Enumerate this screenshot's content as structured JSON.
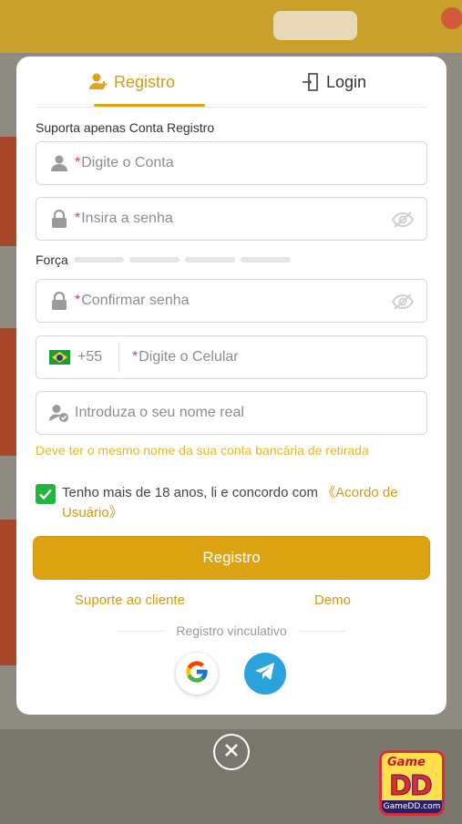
{
  "tabs": {
    "register_label": "Registro",
    "login_label": "Login"
  },
  "note": "Suporta apenas Conta Registro",
  "fields": {
    "account": {
      "required_mark": "*",
      "placeholder": "Digite o Conta"
    },
    "password": {
      "required_mark": "*",
      "placeholder": "Insira a senha"
    },
    "confirm": {
      "required_mark": "*",
      "placeholder": "Confirmar senha"
    },
    "phone": {
      "country_code": "+55",
      "required_mark": "*",
      "placeholder": "Digite o Celular"
    },
    "real_name": {
      "placeholder": "Introduza o seu nome real"
    }
  },
  "strength_label": "Força",
  "real_name_hint": "Deve ter o mesmo nome da sua conta bancária de retirada",
  "agreement": {
    "text": "Tenho mais de 18 anos, li e concordo com ",
    "link": "《Acordo de Usuário》",
    "checked": true
  },
  "submit_label": "Registro",
  "links": {
    "support": "Suporte ao cliente",
    "demo": "Demo"
  },
  "binding_label": "Registro vinculativo",
  "social": [
    "google-icon",
    "telegram-icon"
  ],
  "logo": {
    "top": "Game",
    "main": "DD",
    "domain": "GameDD.com"
  },
  "colors": {
    "accent": "#dea312",
    "link": "#d79a12",
    "hint": "#e7b71f",
    "required": "#e23d3d",
    "check": "#1fb53f",
    "telegram": "#2aa3dd"
  }
}
